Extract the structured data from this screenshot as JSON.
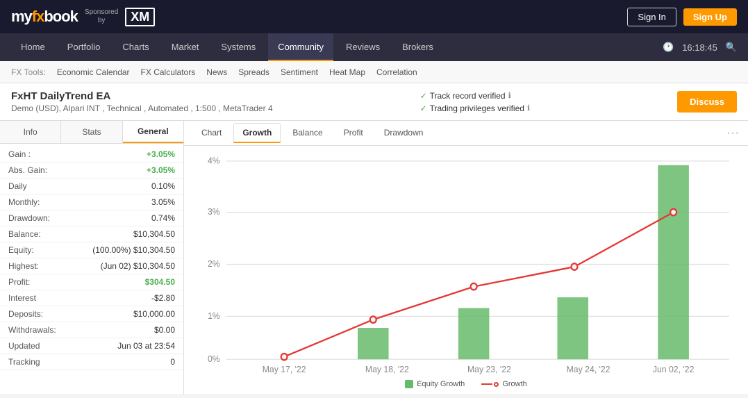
{
  "topbar": {
    "logo_my": "my",
    "logo_fx": "fx",
    "logo_book": "book",
    "sponsored_label": "Sponsored",
    "sponsored_by": "by",
    "xm_label": "XM",
    "signin_label": "Sign In",
    "signup_label": "Sign Up",
    "time": "16:18:45"
  },
  "nav": {
    "items": [
      "Home",
      "Portfolio",
      "Charts",
      "Market",
      "Systems",
      "Community",
      "Reviews",
      "Brokers"
    ],
    "active": "Community"
  },
  "tools": {
    "label": "FX Tools:",
    "items": [
      "Economic Calendar",
      "FX Calculators",
      "News",
      "Spreads",
      "Sentiment",
      "Heat Map",
      "Correlation"
    ]
  },
  "system": {
    "title": "FxHT DailyTrend EA",
    "subtitle": "Demo (USD), Alpari INT , Technical , Automated , 1:500 , MetaTrader 4",
    "badge1": "Track record verified",
    "badge2": "Trading privileges verified",
    "discuss_label": "Discuss"
  },
  "left_panel": {
    "tabs": [
      "Info",
      "Stats",
      "General"
    ],
    "active_tab": "General",
    "stats": [
      {
        "label": "Gain :",
        "value": "+3.05%",
        "class": "green"
      },
      {
        "label": "Abs. Gain:",
        "value": "+3.05%",
        "class": "green"
      },
      {
        "label": "Daily",
        "value": "0.10%",
        "class": ""
      },
      {
        "label": "Monthly:",
        "value": "3.05%",
        "class": ""
      },
      {
        "label": "Drawdown:",
        "value": "0.74%",
        "class": ""
      },
      {
        "label": "Balance:",
        "value": "$10,304.50",
        "class": ""
      },
      {
        "label": "Equity:",
        "value": "(100.00%) $10,304.50",
        "class": ""
      },
      {
        "label": "Highest:",
        "value": "(Jun 02) $10,304.50",
        "class": ""
      },
      {
        "label": "Profit:",
        "value": "$304.50",
        "class": "green"
      },
      {
        "label": "Interest",
        "value": "-$2.80",
        "class": ""
      },
      {
        "label": "Deposits:",
        "value": "$10,000.00",
        "class": ""
      },
      {
        "label": "Withdrawals:",
        "value": "$0.00",
        "class": ""
      },
      {
        "label": "Updated",
        "value": "Jun 03 at 23:54",
        "class": ""
      },
      {
        "label": "Tracking",
        "value": "0",
        "class": ""
      }
    ]
  },
  "chart_panel": {
    "tabs": [
      "Chart",
      "Growth",
      "Balance",
      "Profit",
      "Drawdown"
    ],
    "active_tab": "Growth",
    "legend": [
      {
        "type": "bar_green",
        "label": "Equity Growth"
      },
      {
        "type": "line_red",
        "label": "Growth"
      }
    ],
    "x_labels": [
      "May 17, '22",
      "May 18, '22",
      "May 23, '22",
      "May 24, '22",
      "Jun 02, '22"
    ],
    "y_labels": [
      "0%",
      "1%",
      "2%",
      "3%",
      "4%"
    ],
    "bars": [
      0,
      0.6,
      0.9,
      1.1,
      3.7
    ],
    "line_points": [
      0.05,
      0.7,
      1.6,
      1.95,
      3.1
    ]
  }
}
